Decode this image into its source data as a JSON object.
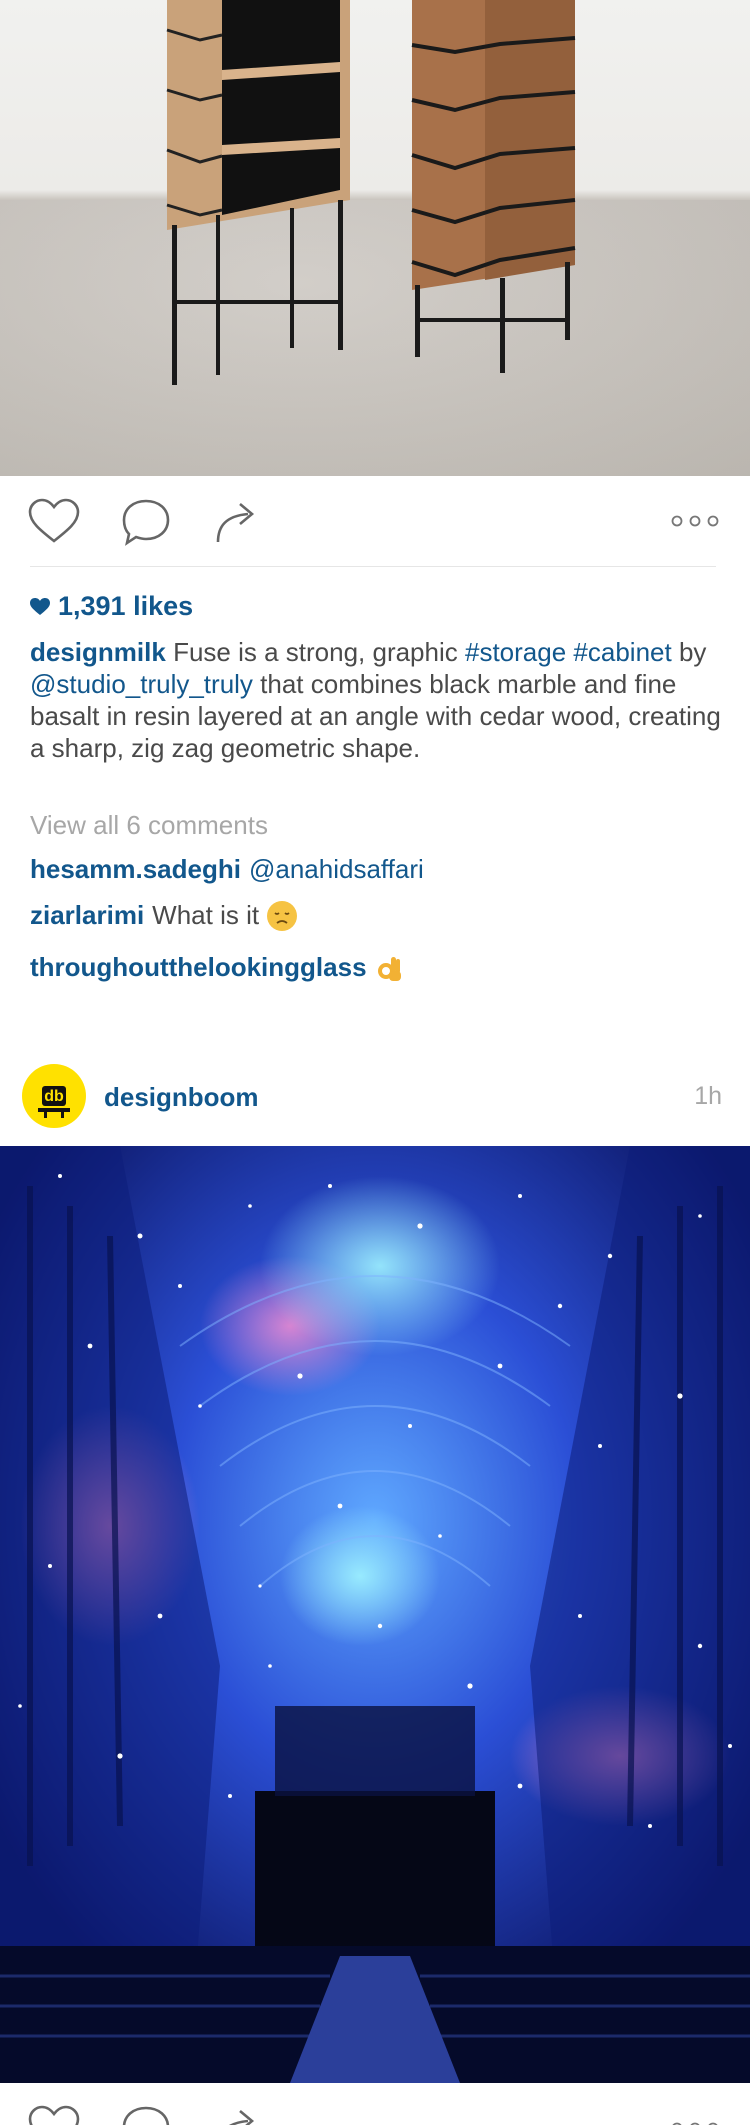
{
  "post1": {
    "likes": "1,391 likes",
    "caption_user": "designmilk",
    "caption_parts": [
      "Fuse is a strong, graphic ",
      "#storage",
      " ",
      "#cabinet",
      " by ",
      "@studio_truly_truly",
      " that combines black marble and fine basalt in resin layered at an angle with cedar wood, creating a sharp, zig zag geometric shape."
    ],
    "view_all": "View all 6 comments",
    "comments": [
      {
        "user": "hesamm.sadeghi",
        "text": "@anahidsaffari",
        "emoji": ""
      },
      {
        "user": "ziarlarimi",
        "text": "What is it",
        "emoji": "disappointed-face"
      },
      {
        "user": "throughoutthelookingglass",
        "text": "",
        "emoji": "ok-hand"
      }
    ]
  },
  "post2": {
    "username": "designboom",
    "time": "1h",
    "avatar_text": "db"
  },
  "colors": {
    "link_blue": "#12578c",
    "muted_gray": "#a7a7a7",
    "body_text": "#4a4a4a",
    "avatar_yellow": "#ffe100"
  },
  "icons": [
    "heart-icon",
    "comment-icon",
    "share-icon",
    "more-options-icon"
  ]
}
